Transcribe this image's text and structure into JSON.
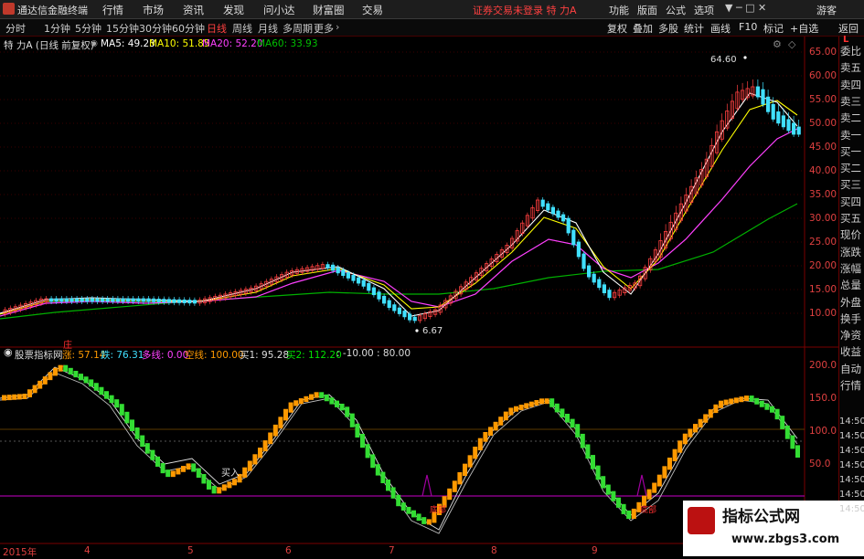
{
  "titlebar": {
    "app": "通达信金融终端",
    "menus": [
      "行情",
      "市场",
      "资讯",
      "发现",
      "问小达",
      "财富圈",
      "交易"
    ],
    "notice": "证券交易未登录  特 力A",
    "right": [
      "功能",
      "版面",
      "公式",
      "选项"
    ],
    "guest": "游客"
  },
  "toolbar": {
    "periods": [
      "分时",
      "1分钟",
      "5分钟",
      "15分钟",
      "30分钟",
      "60分钟",
      "日线",
      "周线",
      "月线",
      "多周期",
      "更多"
    ],
    "active": "日线",
    "right": [
      "复权",
      "叠加",
      "多股",
      "统计",
      "画线",
      "F10",
      "标记",
      "+自选",
      "返回"
    ]
  },
  "price_info": {
    "title": "特 力A (日线 前复权)",
    "ma5": "MA5: 49.23",
    "ma10": "MA10: 51.85",
    "ma20": "MA20: 52.20",
    "ma60": "MA60: 33.93"
  },
  "price_axis": [
    "65.00",
    "60.00",
    "55.00",
    "50.00",
    "45.00",
    "40.00",
    "35.00",
    "30.00",
    "25.00",
    "20.00",
    "15.00",
    "10.00"
  ],
  "annotations": {
    "high": "64.60",
    "low": "6.67"
  },
  "indicator_info": {
    "name": "股票指标网",
    "rise": "涨: 57.14",
    "fall": "跌: 76.31",
    "long": "多线: 0.00",
    "short": "空线: 100.00",
    "buy1": "买1: 95.28",
    "buy2": "买2: 112.20",
    "rest": ": -10.00 : 80.00",
    "top_marker": "庄"
  },
  "indicator_axis": [
    "200.0",
    "150.0",
    "100.0",
    "50.0"
  ],
  "indicator_right_labels": [
    "14:50",
    "14:50",
    "14:50",
    "14:50",
    "14:50",
    "14:50",
    "14:50"
  ],
  "chart_marks": {
    "buy_in": "买入",
    "bottom_1": "底部",
    "bottom_2": "底部"
  },
  "date_axis": [
    "2015年",
    "4",
    "5",
    "6",
    "7",
    "8",
    "9"
  ],
  "side_panel": [
    "委比",
    "卖五",
    "卖四",
    "卖三",
    "卖二",
    "卖一",
    "买一",
    "买二",
    "买三",
    "买四",
    "买五",
    "现价",
    "涨跌",
    "涨幅",
    "总量",
    "外盘",
    "换手",
    "净资",
    "收益",
    "自动",
    "行情"
  ],
  "watermark": {
    "line1": "指标公式网",
    "line2": "www.zbgs3.com"
  },
  "colors": {
    "up": "#ff4040",
    "down": "#40e0ff",
    "ma5": "#ffffff",
    "ma10": "#ffff00",
    "ma20": "#ff40ff",
    "ma60": "#00c000",
    "ind_up": "#ff9900",
    "ind_down": "#33dd33"
  },
  "chart_data": [
    {
      "type": "line",
      "title": "特 力A (日线 前复权)",
      "ylim": [
        5,
        68
      ],
      "series": [
        {
          "name": "MA60",
          "values": [
            8.2,
            9.0,
            10.0,
            11.0,
            12.0,
            13.3,
            14.5,
            15.8,
            17.0,
            18.5,
            21.0,
            26.0,
            30.0,
            33.9
          ]
        }
      ]
    },
    {
      "type": "line",
      "title": "股票指标网",
      "ylim": [
        -10,
        210
      ],
      "series": [
        {
          "name": "涨",
          "values": [
            150,
            200,
            160,
            80,
            50,
            40,
            60,
            150,
            150,
            100,
            30,
            -5,
            40,
            150,
            200,
            150,
            40,
            -5,
            80,
            150,
            150,
            100
          ]
        }
      ]
    }
  ]
}
